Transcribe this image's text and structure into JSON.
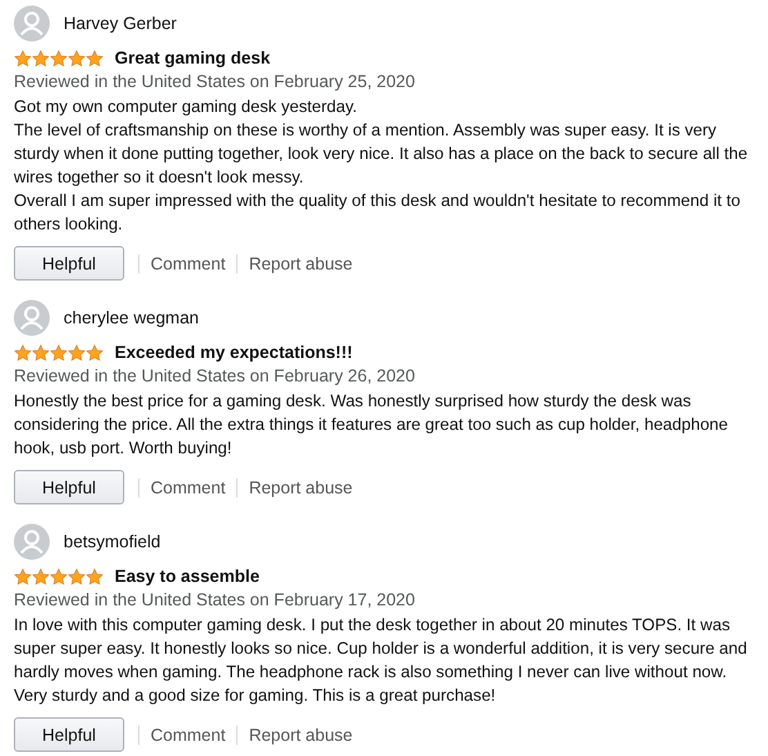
{
  "reviews": [
    {
      "author": "Harvey Gerber",
      "stars": 5,
      "title": "Great gaming desk",
      "date": "Reviewed in the United States on February 25, 2020",
      "paragraphs": [
        "Got my own computer gaming desk yesterday.",
        "The level of craftsmanship on these is worthy of a mention. Assembly was super easy. It is very sturdy when it done putting together, look very nice. It also has a place on the back to secure all the wires together so it doesn't look messy.",
        "Overall I am super impressed with the quality of this desk and wouldn't hesitate to recommend it to others looking."
      ],
      "actions": {
        "helpful": "Helpful",
        "comment": "Comment",
        "report": "Report abuse"
      }
    },
    {
      "author": "cherylee wegman",
      "stars": 5,
      "title": "Exceeded my expectations!!!",
      "date": "Reviewed in the United States on February 26, 2020",
      "paragraphs": [
        "Honestly the best price for a gaming desk. Was honestly surprised how sturdy the desk was considering the price. All the extra things it features are great too such as cup holder, headphone hook, usb port. Worth buying!"
      ],
      "actions": {
        "helpful": "Helpful",
        "comment": "Comment",
        "report": "Report abuse"
      }
    },
    {
      "author": "betsymofield",
      "stars": 5,
      "title": "Easy to assemble",
      "date": "Reviewed in the United States on February 17, 2020",
      "paragraphs": [
        "In love with this computer gaming desk. I put the desk together in about 20 minutes TOPS. It was super super easy. It honestly looks so nice. Cup holder is a wonderful addition, it is very secure and hardly moves when gaming. The headphone rack is also something I never can live without now. Very sturdy and a good size for gaming. This is a great purchase!"
      ],
      "actions": {
        "helpful": "Helpful",
        "comment": "Comment",
        "report": "Report abuse"
      }
    }
  ]
}
